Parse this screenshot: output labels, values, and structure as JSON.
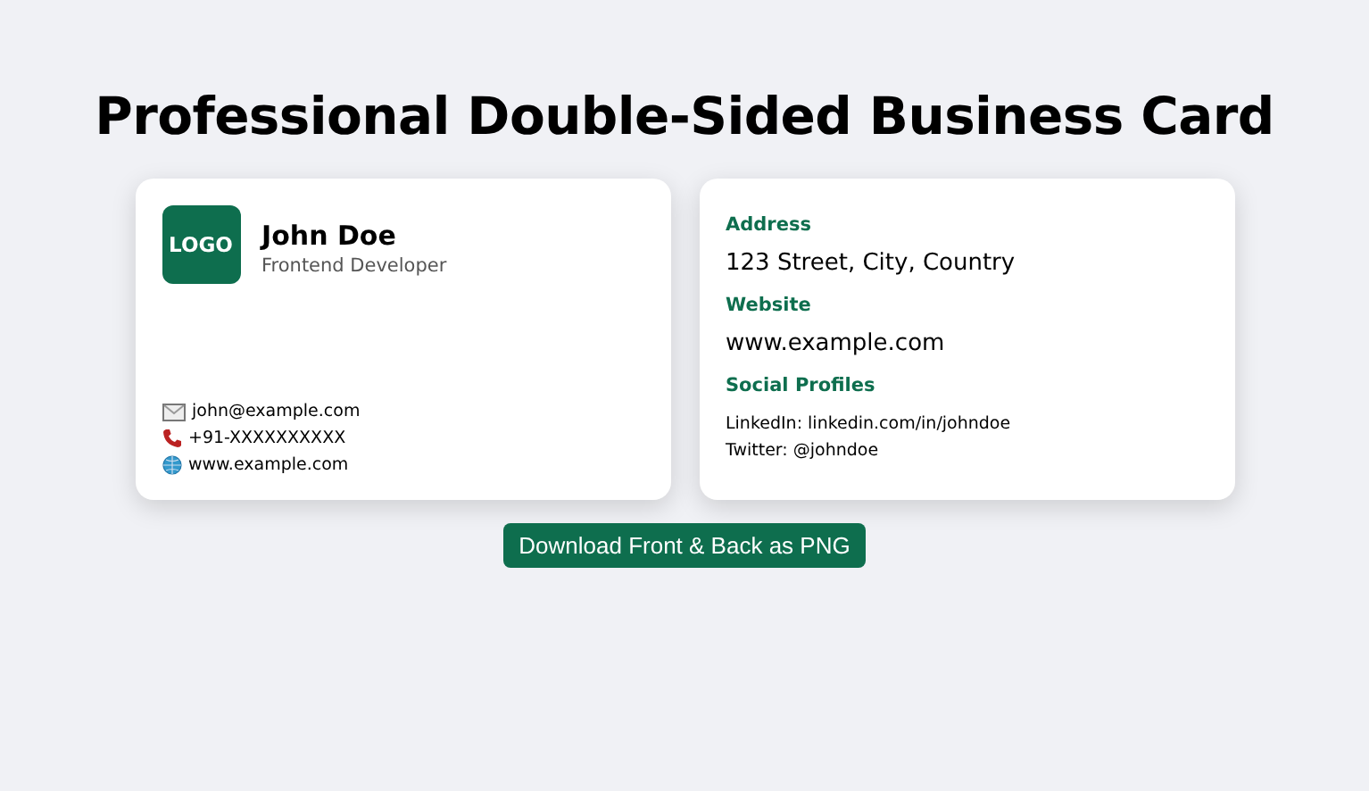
{
  "title": "Professional Double-Sided Business Card",
  "front": {
    "logo": "LOGO",
    "name": "John Doe",
    "role": "Frontend Developer",
    "contacts": [
      {
        "kind": "email",
        "text": "john@example.com"
      },
      {
        "kind": "phone",
        "text": "+91-XXXXXXXXXX"
      },
      {
        "kind": "web",
        "text": "www.example.com"
      }
    ]
  },
  "back": {
    "sections": [
      {
        "heading": "Address",
        "lines": [
          "123 Street, City, Country"
        ],
        "kind": "large"
      },
      {
        "heading": "Website",
        "lines": [
          "www.example.com"
        ],
        "kind": "large"
      },
      {
        "heading": "Social Profiles",
        "lines": [
          "LinkedIn: linkedin.com/in/johndoe",
          "Twitter: @johndoe"
        ],
        "kind": "small"
      }
    ]
  },
  "button": "Download Front & Back as PNG"
}
